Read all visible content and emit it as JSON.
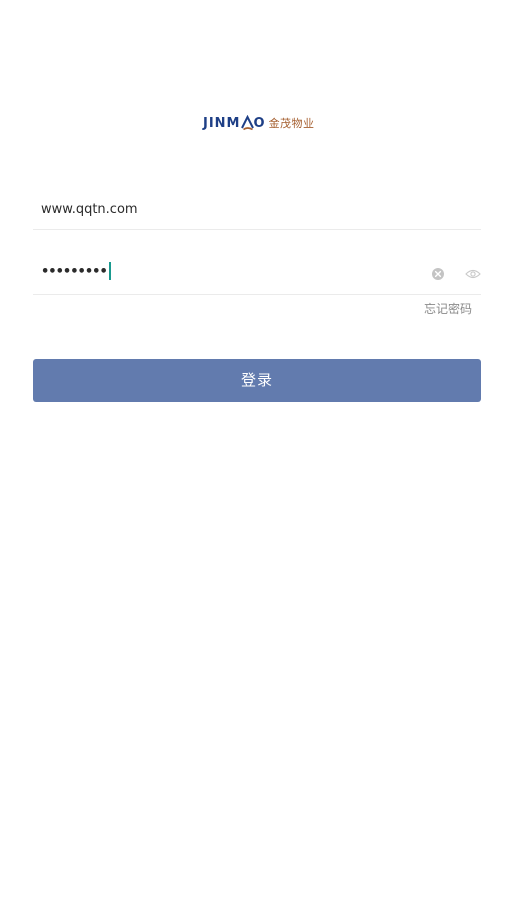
{
  "logo": {
    "brand_en_prefix": "JINM",
    "brand_en_suffix": "O",
    "brand_cn": "金茂物业"
  },
  "username": {
    "value": "www.qqtn.com"
  },
  "password": {
    "masked_value": "•••••••••"
  },
  "forgot_password_label": "忘记密码",
  "login_button_label": "登录",
  "colors": {
    "brand_navy": "#1e3f86",
    "brand_copper": "#a55f2f",
    "button_bg": "#627bae",
    "caret": "#1a9a8f",
    "divider": "#ebebeb",
    "muted_text": "#8a8a8a"
  },
  "icons": {
    "clear": "clear-icon",
    "toggle_visibility": "eye-icon",
    "logo_mark": "jinmao-a-mark-icon"
  }
}
